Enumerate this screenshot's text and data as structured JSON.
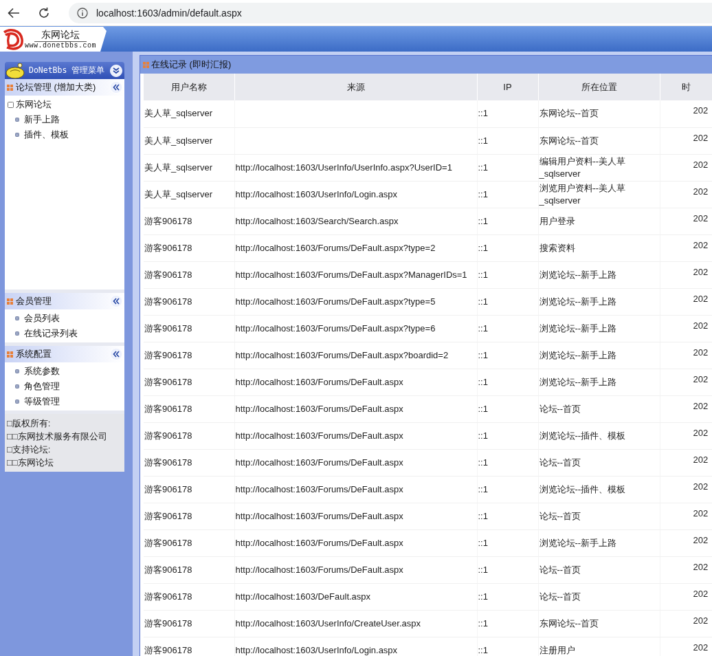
{
  "browser": {
    "url": "localhost:1603/admin/default.aspx"
  },
  "header": {
    "site_name": "东网论坛",
    "site_url": "www.donetbbs.com"
  },
  "sidebar": {
    "title": "DoNetBbs 管理菜单",
    "sections": [
      {
        "title": "论坛管理 (增加大类)",
        "kind": "tree",
        "items": [
          {
            "label": "东网论坛",
            "children": [
              {
                "label": "新手上路"
              },
              {
                "label": "插件、模板"
              }
            ]
          }
        ]
      },
      {
        "title": "会员管理",
        "kind": "list",
        "items": [
          {
            "label": "会员列表"
          },
          {
            "label": "在线记录列表"
          }
        ]
      },
      {
        "title": "系统配置",
        "kind": "list",
        "items": [
          {
            "label": "系统参数"
          },
          {
            "label": "角色管理"
          },
          {
            "label": "等级管理"
          }
        ]
      }
    ],
    "footer": [
      "□版权所有:",
      "□□东网技术服务有限公司",
      "□支持论坛:",
      "□□东网论坛"
    ]
  },
  "panel": {
    "title": "在线记录 (即时汇报)",
    "table": {
      "columns": [
        "用户名称",
        "来源",
        "IP",
        "所在位置",
        "时"
      ],
      "rows": [
        {
          "user": "美人草_sqlserver",
          "ip": "::1",
          "location": "东网论坛--首页",
          "time": "202"
        },
        {
          "user": "美人草_sqlserver",
          "ip": "::1",
          "location": "东网论坛--首页",
          "time": "202"
        },
        {
          "user": "美人草_sqlserver",
          "source": "http://localhost:1603/UserInfo/UserInfo.aspx?UserID=1",
          "ip": "::1",
          "location": "编辑用户资料--美人草_sqlserver",
          "time": "202"
        },
        {
          "user": "美人草_sqlserver",
          "source": "http://localhost:1603/UserInfo/Login.aspx",
          "ip": "::1",
          "location": "浏览用户资料--美人草_sqlserver",
          "time": "202"
        },
        {
          "user": "游客906178",
          "source": "http://localhost:1603/Search/Search.aspx",
          "ip": "::1",
          "location": "用户登录",
          "time": "202"
        },
        {
          "user": "游客906178",
          "source": "http://localhost:1603/Forums/DeFault.aspx?type=2",
          "ip": "::1",
          "location": "搜索资料",
          "time": "202"
        },
        {
          "user": "游客906178",
          "source": "http://localhost:1603/Forums/DeFault.aspx?ManagerIDs=1",
          "ip": "::1",
          "location": "浏览论坛--新手上路",
          "time": "202"
        },
        {
          "user": "游客906178",
          "source": "http://localhost:1603/Forums/DeFault.aspx?type=5",
          "ip": "::1",
          "location": "浏览论坛--新手上路",
          "time": "202"
        },
        {
          "user": "游客906178",
          "source": "http://localhost:1603/Forums/DeFault.aspx?type=6",
          "ip": "::1",
          "location": "浏览论坛--新手上路",
          "time": "202"
        },
        {
          "user": "游客906178",
          "source": "http://localhost:1603/Forums/DeFault.aspx?boardid=2",
          "ip": "::1",
          "location": "浏览论坛--新手上路",
          "time": "202"
        },
        {
          "user": "游客906178",
          "source": "http://localhost:1603/Forums/DeFault.aspx",
          "ip": "::1",
          "location": "浏览论坛--新手上路",
          "time": "202"
        },
        {
          "user": "游客906178",
          "source": "http://localhost:1603/Forums/DeFault.aspx",
          "ip": "::1",
          "location": "论坛--首页",
          "time": "202"
        },
        {
          "user": "游客906178",
          "source": "http://localhost:1603/Forums/DeFault.aspx",
          "ip": "::1",
          "location": "浏览论坛--插件、模板",
          "time": "202"
        },
        {
          "user": "游客906178",
          "source": "http://localhost:1603/Forums/DeFault.aspx",
          "ip": "::1",
          "location": "论坛--首页",
          "time": "202"
        },
        {
          "user": "游客906178",
          "source": "http://localhost:1603/Forums/DeFault.aspx",
          "ip": "::1",
          "location": "浏览论坛--插件、模板",
          "time": "202"
        },
        {
          "user": "游客906178",
          "source": "http://localhost:1603/Forums/DeFault.aspx",
          "ip": "::1",
          "location": "论坛--首页",
          "time": "202"
        },
        {
          "user": "游客906178",
          "source": "http://localhost:1603/Forums/DeFault.aspx",
          "ip": "::1",
          "location": "浏览论坛--新手上路",
          "time": "202"
        },
        {
          "user": "游客906178",
          "source": "http://localhost:1603/Forums/DeFault.aspx",
          "ip": "::1",
          "location": "论坛--首页",
          "time": "202"
        },
        {
          "user": "游客906178",
          "source": "http://localhost:1603/DeFault.aspx",
          "ip": "::1",
          "location": "论坛--首页",
          "time": "202"
        },
        {
          "user": "游客906178",
          "source": "http://localhost:1603/UserInfo/CreateUser.aspx",
          "ip": "::1",
          "location": "东网论坛--首页",
          "time": "202"
        },
        {
          "user": "游客906178",
          "source": "http://localhost:1603/UserInfo/Login.aspx",
          "ip": "::1",
          "location": "注册用户",
          "time": "202"
        }
      ]
    }
  }
}
